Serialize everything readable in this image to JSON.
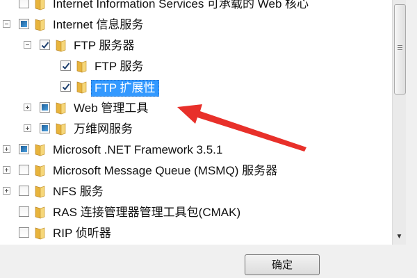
{
  "features": [
    {
      "label": "Internet Information Services 可承载的 Web 核心",
      "level": 0,
      "expander": "none",
      "check": "unchecked"
    },
    {
      "label": "Internet 信息服务",
      "level": 0,
      "expander": "minus",
      "check": "partial"
    },
    {
      "label": "FTP 服务器",
      "level": 1,
      "expander": "minus",
      "check": "checked"
    },
    {
      "label": "FTP 服务",
      "level": 2,
      "expander": "none",
      "check": "checked"
    },
    {
      "label": "FTP 扩展性",
      "level": 2,
      "expander": "none",
      "check": "checked",
      "selected": true
    },
    {
      "label": "Web 管理工具",
      "level": 1,
      "expander": "plus",
      "check": "partial"
    },
    {
      "label": "万维网服务",
      "level": 1,
      "expander": "plus",
      "check": "partial"
    },
    {
      "label": "Microsoft .NET Framework 3.5.1",
      "level": 0,
      "expander": "plus",
      "check": "partial"
    },
    {
      "label": "Microsoft Message Queue (MSMQ) 服务器",
      "level": 0,
      "expander": "plus",
      "check": "unchecked"
    },
    {
      "label": "NFS 服务",
      "level": 0,
      "expander": "plus",
      "check": "unchecked"
    },
    {
      "label": "RAS 连接管理器管理工具包(CMAK)",
      "level": 0,
      "expander": "none",
      "check": "unchecked"
    },
    {
      "label": "RIP 侦听器",
      "level": 0,
      "expander": "none",
      "check": "unchecked"
    }
  ],
  "buttons": {
    "ok_label": "确定"
  },
  "colors": {
    "selection": "#3399ff",
    "arrow": "#e8302a",
    "folder": "#f2c24f"
  },
  "icons": {
    "folder": "folder-icon",
    "check": "checkmark-icon",
    "expand": "expand-icon",
    "collapse": "collapse-icon"
  }
}
